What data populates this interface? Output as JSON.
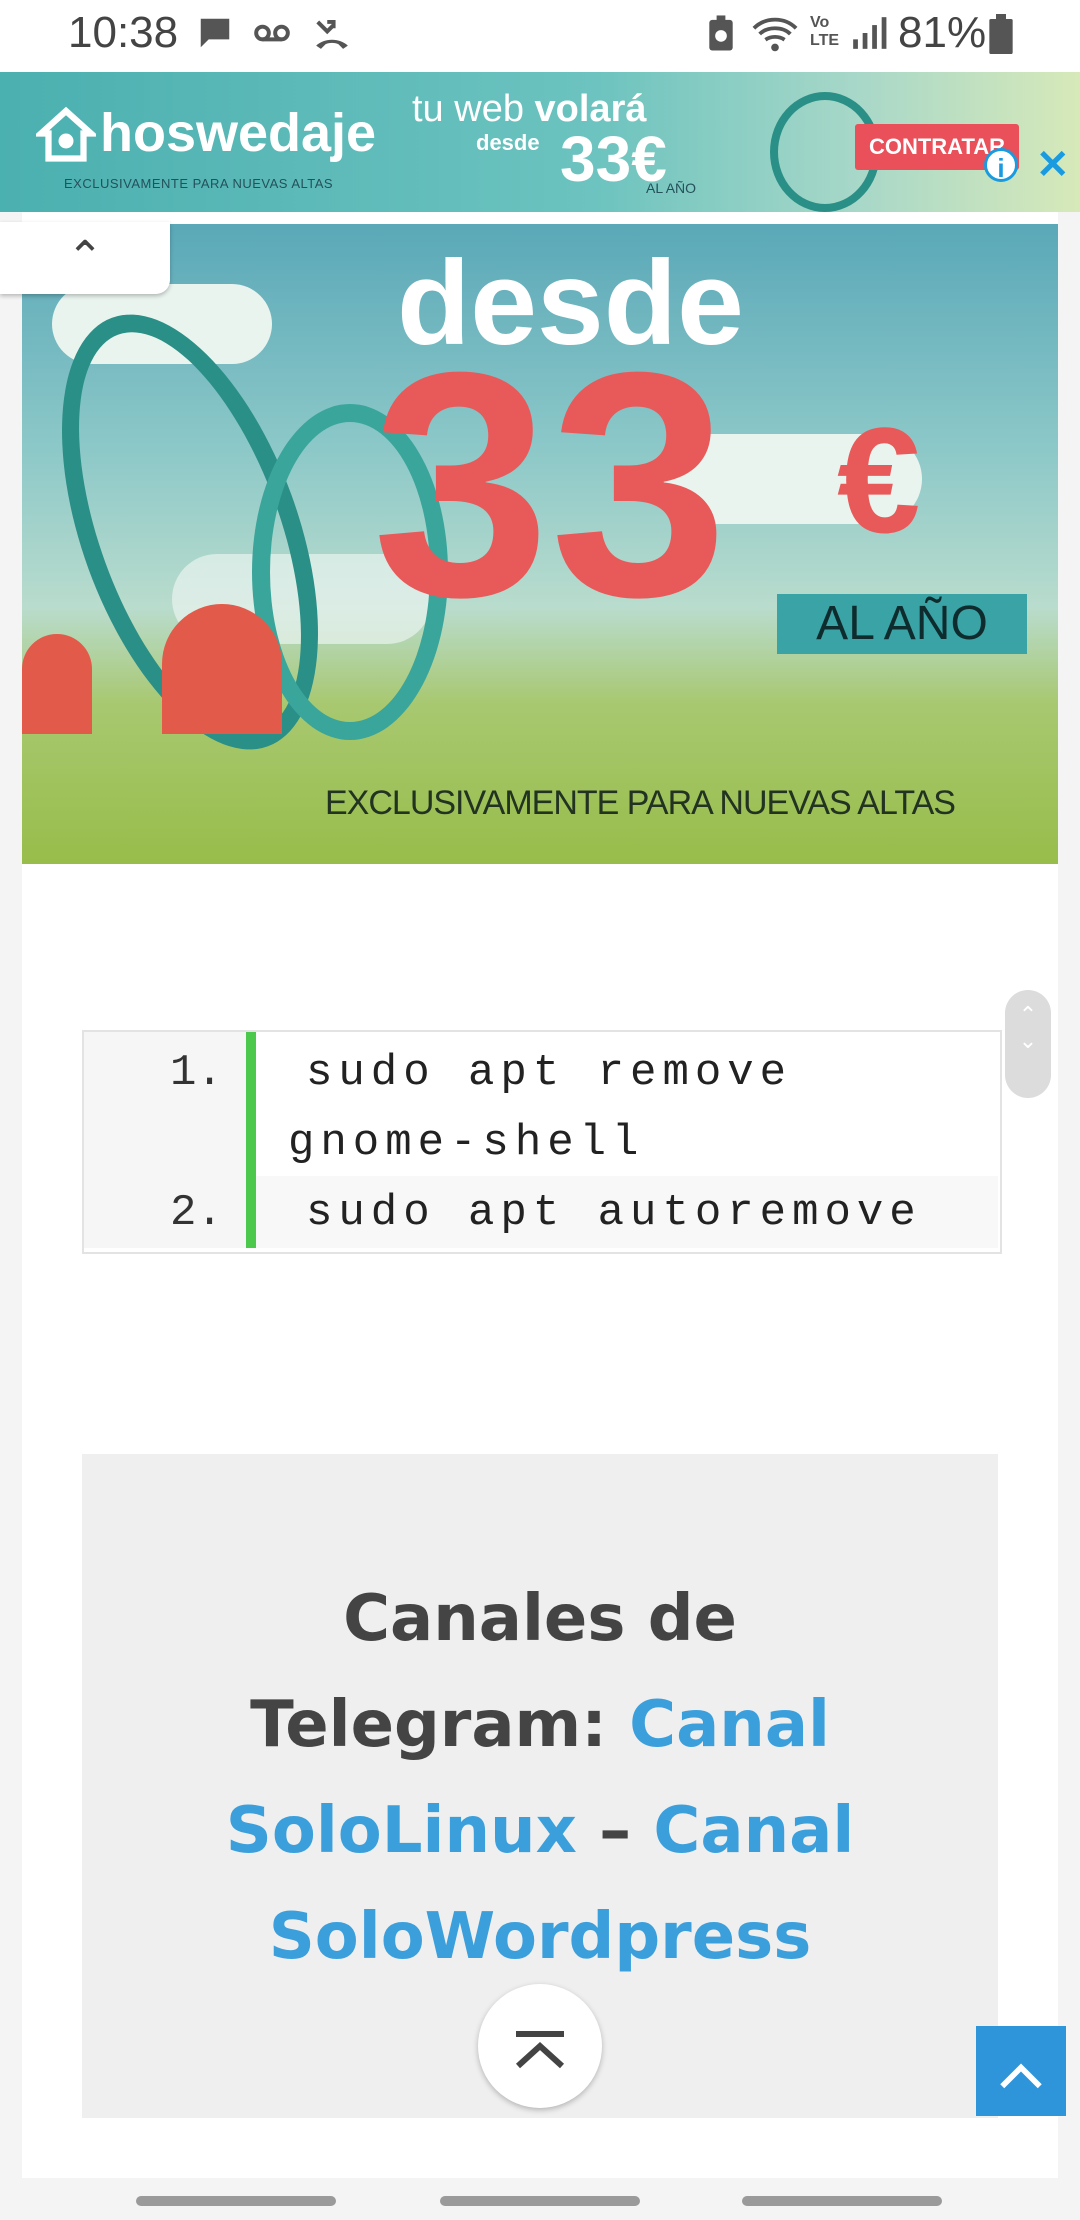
{
  "status": {
    "time": "10:38",
    "icons": [
      "message-icon",
      "voicemail-icon",
      "missed-call-icon",
      "battery-saver-icon",
      "wifi-icon",
      "volte-icon",
      "signal-icon",
      "battery-icon"
    ],
    "volte": "Vo LTE",
    "battery": "81%"
  },
  "top_ad": {
    "logo": "hoswedaje",
    "logo_sub": "EXCLUSIVAMENTE PARA NUEVAS ALTAS",
    "tu_web": "tu web",
    "volara": "volará",
    "desde": "desde",
    "price": "33€",
    "al_ano": "AL AÑO",
    "cta": "CONTRATAR",
    "info": "i",
    "close": "✕"
  },
  "big_ad": {
    "desde": "desde",
    "number": "33",
    "euro": "€",
    "al_ano": "AL AÑO",
    "exclusive": "EXCLUSIVAMENTE PARA NUEVAS ALTAS"
  },
  "collapse": {
    "icon": "chevron-up-icon",
    "glyph": "⌃"
  },
  "code": {
    "lines": [
      {
        "num": "1.",
        "text": " sudo apt remove",
        "cont": "gnome-shell"
      },
      {
        "num": "2.",
        "text": " sudo apt autoremove"
      }
    ]
  },
  "telegram": {
    "heading_1": "Canales de",
    "heading_2": "Telegram:",
    "link1_a": "Canal",
    "link1_b": "SoloLinux",
    "sep": "–",
    "link2_a": "Canal",
    "link2_b": "SoloWordpress"
  },
  "buttons": {
    "scroll_top_glyph": "⌅",
    "to_top_glyph": "⌃"
  },
  "colors": {
    "accent_link": "#3b9fdc",
    "code_bar": "#4cc94c",
    "ad_cta": "#e9505a",
    "to_top": "#2e95db"
  }
}
